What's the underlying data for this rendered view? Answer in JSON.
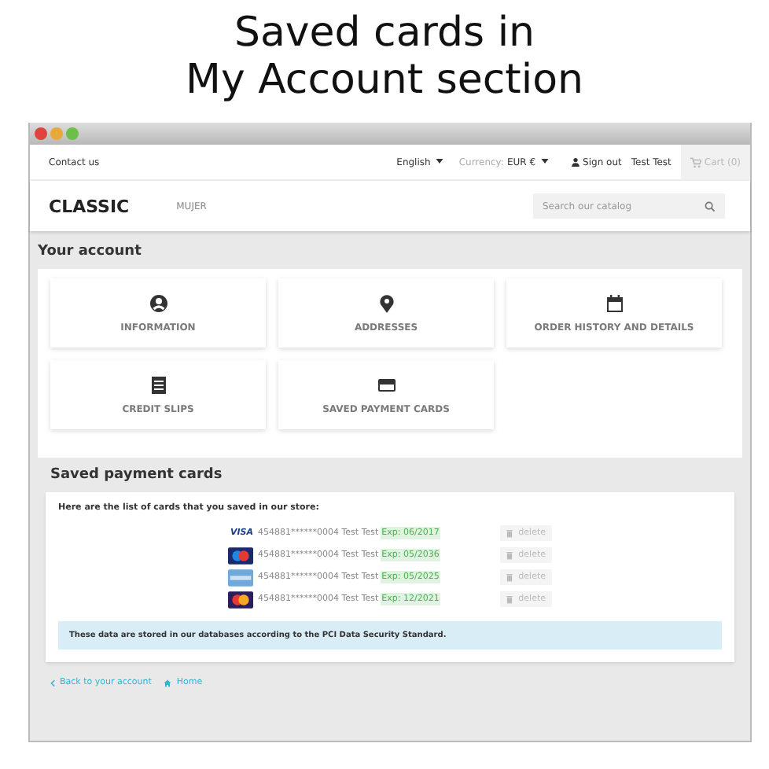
{
  "caption": [
    "Saved cards in",
    "My Account section"
  ],
  "topbar": {
    "contact": "Contact us",
    "language": "English",
    "currency_label": "Currency:",
    "currency": "EUR €",
    "sign_out": "Sign out",
    "user": "Test Test",
    "cart": "Cart (0)"
  },
  "header": {
    "logo": "CLASSIC",
    "menu": [
      "MUJER"
    ],
    "search": {
      "placeholder": "Search our catalog"
    }
  },
  "account": {
    "title": "Your account",
    "tiles": [
      {
        "kind": "user",
        "label": "INFORMATION"
      },
      {
        "kind": "pin",
        "label": "ADDRESSES"
      },
      {
        "kind": "calendar",
        "label": "ORDER HISTORY AND DETAILS"
      },
      {
        "kind": "slip",
        "label": "CREDIT SLIPS"
      },
      {
        "kind": "card",
        "label": "SAVED PAYMENT CARDS"
      }
    ]
  },
  "saved": {
    "title": "Saved payment cards",
    "intro": "Here are the list of cards that you saved in our store:",
    "cards": [
      {
        "kind": "visa",
        "logo_text": "VISA",
        "number": "454881******0004 Test Test",
        "expiry": "Exp: 06/2017",
        "action": "delete"
      },
      {
        "kind": "maestro",
        "number": "454881******0004 Test Test",
        "expiry": "Exp: 05/2036",
        "action": "delete"
      },
      {
        "kind": "amex",
        "number": "454881******0004 Test Test",
        "expiry": "Exp: 05/2025",
        "action": "delete"
      },
      {
        "kind": "mastercard",
        "number": "454881******0004 Test Test",
        "expiry": "Exp: 12/2021",
        "action": "delete"
      }
    ],
    "notice": "These data are stored in our databases according to the PCI Data Security Standard."
  },
  "footer_links": [
    {
      "kind": "back",
      "label": "Back to your account"
    },
    {
      "kind": "home",
      "label": "Home"
    }
  ]
}
